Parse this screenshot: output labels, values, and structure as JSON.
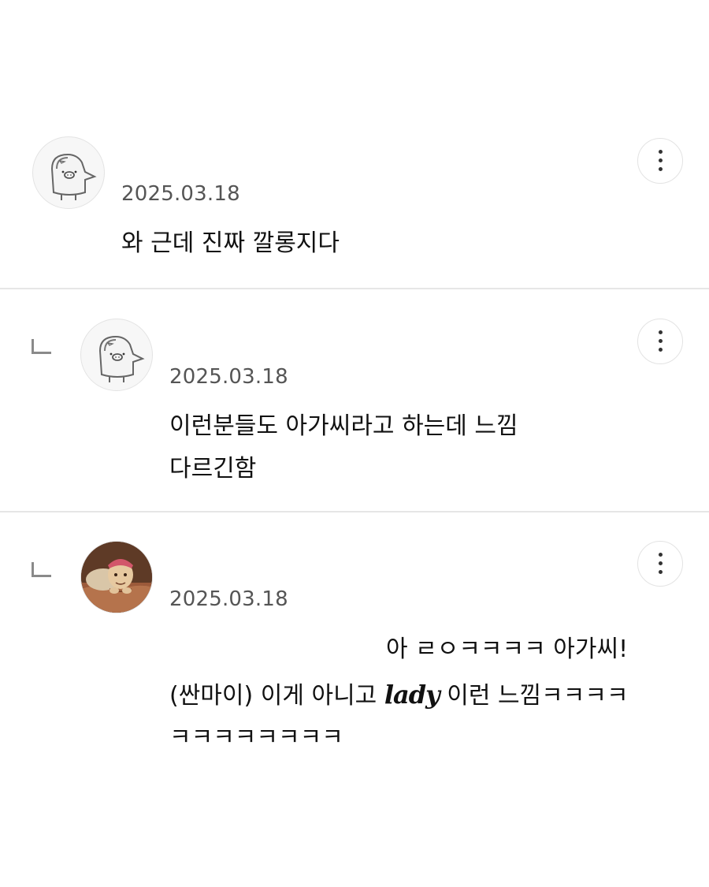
{
  "comments": [
    {
      "avatar_icon": "penguin-pig-avatar-icon",
      "date": "2025.03.18",
      "lines": [
        "와 근데 진짜 깔롱지다"
      ],
      "more_icon": "more-vertical-icon"
    },
    {
      "is_reply": true,
      "reply_icon": "reply-arrow-icon",
      "avatar_icon": "penguin-pig-avatar-icon",
      "date": "2025.03.18",
      "lines": [
        "이런분들도 아가씨라고 하는데 느낌",
        "다르긴함"
      ],
      "more_icon": "more-vertical-icon"
    },
    {
      "is_reply": true,
      "reply_icon": "reply-arrow-icon",
      "avatar_icon": "old-lady-in-bed-avatar-icon",
      "date": "2025.03.18",
      "line1": "아 ㄹㅇㅋㅋㅋㅋ 아가씨!",
      "line2_before": "(싼마이) 이게 아니고 ",
      "line2_script": "lady",
      "line2_after": " 이런 느낌ㅋㅋㅋㅋ",
      "line3": "ㅋㅋㅋㅋㅋㅋㅋㅋ",
      "more_icon": "more-vertical-icon"
    }
  ]
}
